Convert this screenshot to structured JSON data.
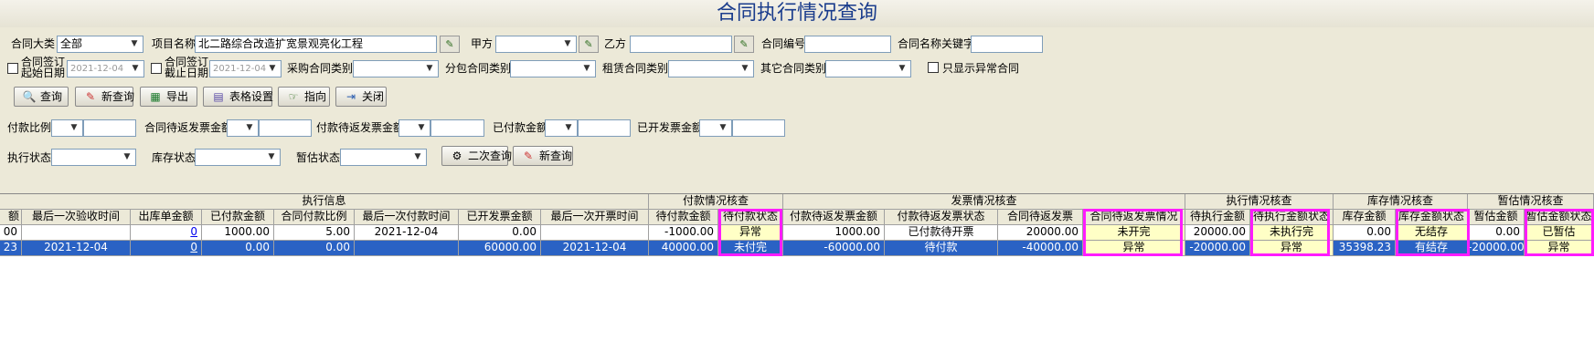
{
  "title": "合同执行情况查询",
  "filters_row1": {
    "contract_category_label": "合同大类",
    "contract_category_value": "全部",
    "project_name_label": "项目名称",
    "project_name_value": "北二路综合改造扩宽景观亮化工程",
    "party_a_label": "甲方",
    "party_a_value": "",
    "party_b_label": "乙方",
    "party_b_value": "",
    "contract_no_label": "合同编号",
    "contract_no_value": "",
    "keyword_label": "合同名称关键字",
    "keyword_value": ""
  },
  "filters_row2": {
    "sign_start_label_1": "合同签订",
    "sign_start_label_2": "起始日期",
    "sign_start_value": "2021-12-04",
    "sign_end_label_1": "合同签订",
    "sign_end_label_2": "截止日期",
    "sign_end_value": "2021-12-04",
    "purchase_type_label": "采购合同类别",
    "subcontract_type_label": "分包合同类别",
    "lease_type_label": "租赁合同类别",
    "other_type_label": "其它合同类别",
    "only_abnormal_label": "只显示异常合同"
  },
  "toolbar": {
    "query": "查询",
    "new_query": "新查询",
    "export": "导出",
    "table_settings": "表格设置",
    "guide": "指向",
    "close": "关闭"
  },
  "filters_row3": {
    "pay_ratio_label": "付款比例",
    "pending_invoice_label": "合同待返发票金额",
    "pay_pending_invoice_label": "付款待返发票金额",
    "paid_label": "已付款金额",
    "invoiced_label": "已开发票金额"
  },
  "filters_row4": {
    "exec_status_label": "执行状态",
    "stock_status_label": "库存状态",
    "estimate_status_label": "暂估状态",
    "second_query": "二次查询",
    "new_query": "新查询"
  },
  "groups": {
    "exec_info": "执行信息",
    "payment_check": "付款情况核查",
    "invoice_check": "发票情况核查",
    "exec_check": "执行情况核查",
    "stock_check": "库存情况核查",
    "estimate_check": "暂估情况核查"
  },
  "columns": [
    "额",
    "最后一次验收时间",
    "出库单金额",
    "已付款金额",
    "合同付款比例",
    "最后一次付款时间",
    "已开发票金额",
    "最后一次开票时间",
    "待付款金额",
    "待付款状态",
    "付款待返发票金额",
    "付款待返发票状态",
    "合同待返发票",
    "合同待返发票情况",
    "待执行金额",
    "待执行金额状态",
    "库存金额",
    "库存金额状态",
    "暂估金额",
    "暂估金额状态"
  ],
  "rows": [
    [
      "00",
      "",
      "0",
      "1000.00",
      "5.00",
      "2021-12-04",
      "0.00",
      "",
      "-1000.00",
      "异常",
      "1000.00",
      "已付款待开票",
      "20000.00",
      "未开完",
      "20000.00",
      "未执行完",
      "0.00",
      "无结存",
      "0.00",
      "已暂估"
    ],
    [
      "23",
      "2021-12-04",
      "0",
      "0.00",
      "0.00",
      "",
      "60000.00",
      "2021-12-04",
      "40000.00",
      "未付完",
      "-60000.00",
      "待付款",
      "-40000.00",
      "异常",
      "-20000.00",
      "异常",
      "35398.23",
      "有结存",
      "-20000.00",
      "异常"
    ]
  ],
  "colors": {
    "title": "#1a3c8c",
    "selected_row": "#2a62c4",
    "highlight_box": "#ff1cff",
    "status_cell": "#ffffc6"
  }
}
